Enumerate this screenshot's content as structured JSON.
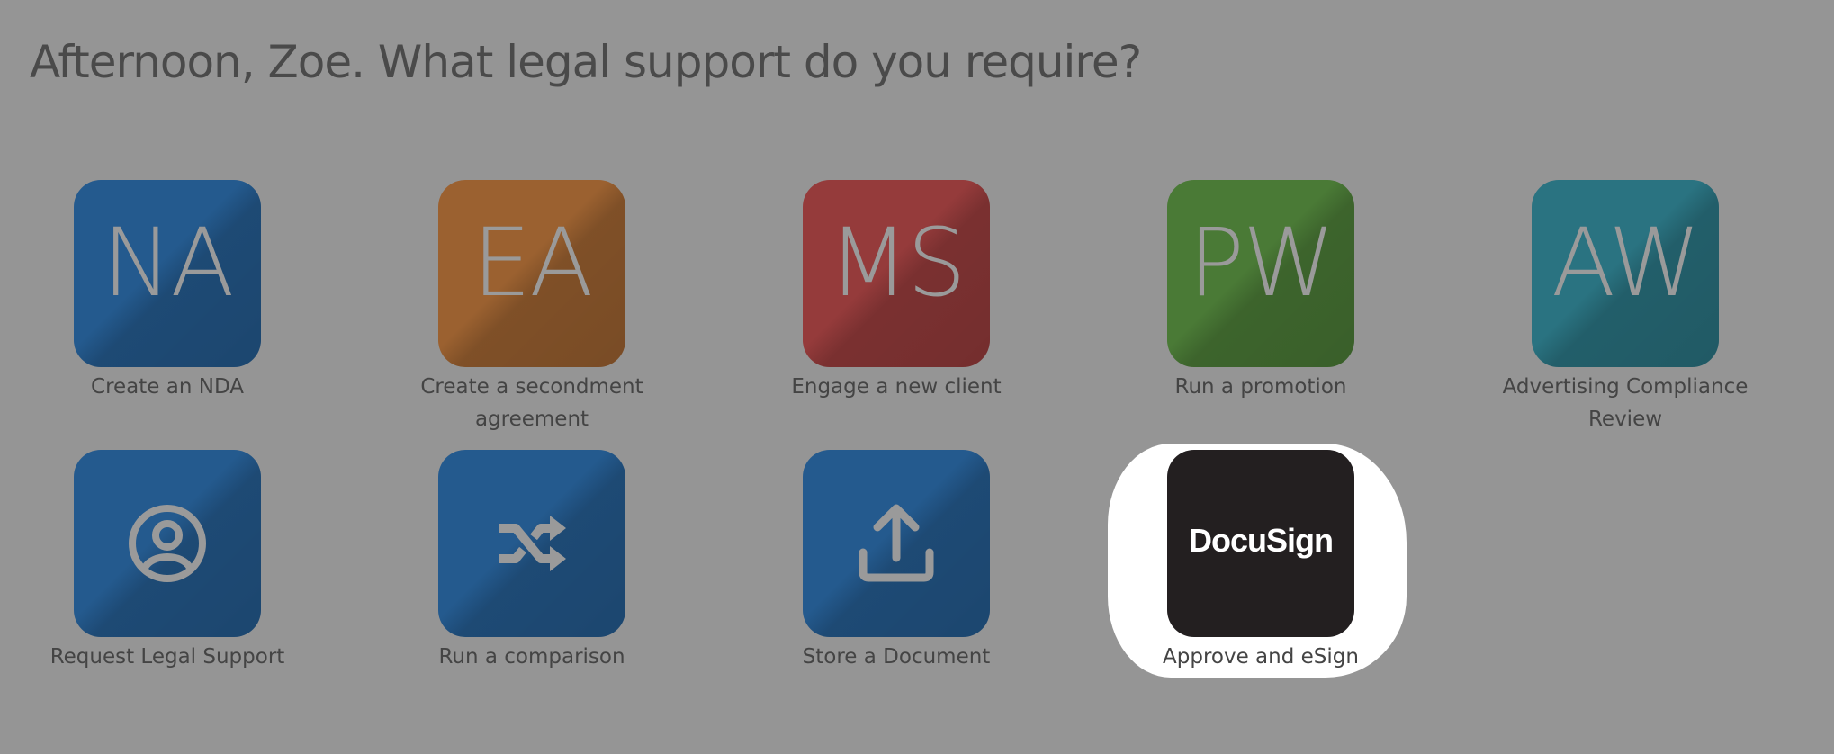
{
  "greeting": "Afternoon, Zoe. What legal support do you require?",
  "colors": {
    "background": "#959595",
    "tile_blue": "#245a8e",
    "tile_orange": "#9b6130",
    "tile_red": "#953b3b",
    "tile_green": "#4a7a36",
    "tile_teal": "#2a7381",
    "tile_docusign": "#231f20",
    "highlight": "#ffffff"
  },
  "tiles": [
    {
      "initials": "NA",
      "label": "Create an NDA",
      "color": "#245a8e"
    },
    {
      "initials": "EA",
      "label": "Create a secondment agreement",
      "color": "#9b6130"
    },
    {
      "initials": "MS",
      "label": "Engage a new client",
      "color": "#953b3b"
    },
    {
      "initials": "PW",
      "label": "Run a promotion",
      "color": "#4a7a36"
    },
    {
      "initials": "AW",
      "label": "Advertising Compliance Review",
      "color": "#2a7381"
    },
    {
      "icon": "user-circle-icon",
      "label": "Request Legal Support",
      "color": "#245a8e"
    },
    {
      "icon": "shuffle-icon",
      "label": "Run a comparison",
      "color": "#245a8e"
    },
    {
      "icon": "upload-icon",
      "label": "Store a Document",
      "color": "#245a8e"
    },
    {
      "logo_text": "DocuSign",
      "label": "Approve and eSign",
      "color": "#231f20",
      "highlighted": true
    }
  ]
}
